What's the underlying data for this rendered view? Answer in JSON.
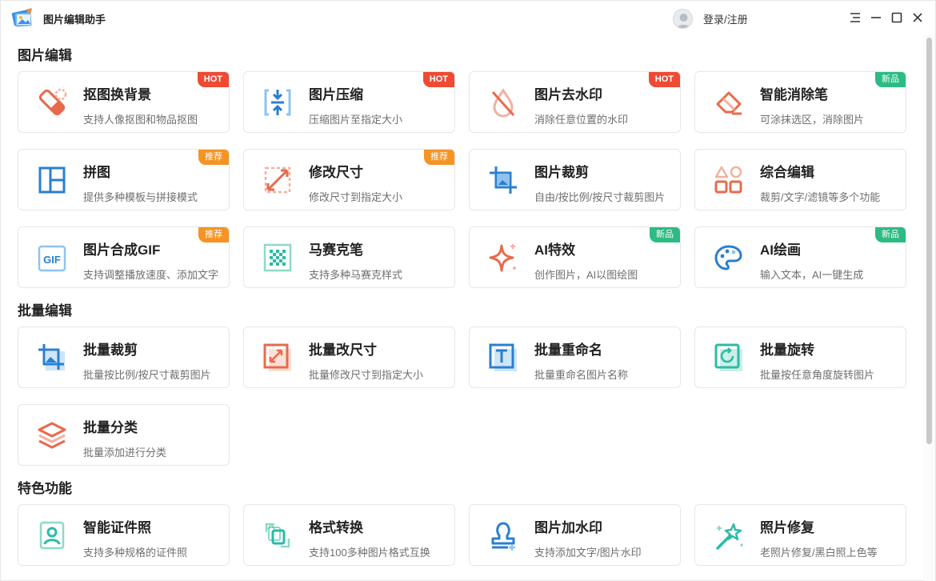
{
  "app": {
    "title": "图片编辑助手",
    "login_label": "登录/注册"
  },
  "colors": {
    "hot": "#ee4a34",
    "recommend": "#f59324",
    "new": "#2dbb84",
    "orange_icon": "#e96a4a",
    "blue_icon": "#2a7fd0",
    "teal_icon": "#2bbba6"
  },
  "sections": [
    {
      "title": "图片编辑",
      "cards": [
        {
          "title": "抠图换背景",
          "desc": "支持人像抠图和物品抠图",
          "badge": "HOT",
          "icon": "eraser-pen-icon"
        },
        {
          "title": "图片压缩",
          "desc": "压缩图片至指定大小",
          "badge": "HOT",
          "icon": "compress-icon"
        },
        {
          "title": "图片去水印",
          "desc": "消除任意位置的水印",
          "badge": "HOT",
          "icon": "water-drop-slash-icon"
        },
        {
          "title": "智能消除笔",
          "desc": "可涂抹选区，消除图片",
          "badge": "新品",
          "icon": "eraser-icon"
        },
        {
          "title": "拼图",
          "desc": "提供多种模板与拼接模式",
          "badge": "推荐",
          "icon": "collage-icon"
        },
        {
          "title": "修改尺寸",
          "desc": "修改尺寸到指定大小",
          "badge": "推荐",
          "icon": "resize-icon"
        },
        {
          "title": "图片裁剪",
          "desc": "自由/按比例/按尺寸裁剪图片",
          "badge": "",
          "icon": "crop-icon"
        },
        {
          "title": "综合编辑",
          "desc": "裁剪/文字/滤镜等多个功能",
          "badge": "",
          "icon": "shapes-icon"
        },
        {
          "title": "图片合成GIF",
          "desc": "支持调整播放速度、添加文字",
          "badge": "推荐",
          "icon": "gif-icon"
        },
        {
          "title": "马赛克笔",
          "desc": "支持多种马赛克样式",
          "badge": "",
          "icon": "mosaic-icon"
        },
        {
          "title": "AI特效",
          "desc": "创作图片，AI以图绘图",
          "badge": "新品",
          "icon": "sparkle-icon"
        },
        {
          "title": "AI绘画",
          "desc": "输入文本，AI一键生成",
          "badge": "新品",
          "icon": "palette-icon"
        }
      ]
    },
    {
      "title": "批量编辑",
      "cards": [
        {
          "title": "批量裁剪",
          "desc": "批量按比例/按尺寸裁剪图片",
          "badge": "",
          "icon": "batch-crop-icon"
        },
        {
          "title": "批量改尺寸",
          "desc": "批量修改尺寸到指定大小",
          "badge": "",
          "icon": "batch-resize-icon"
        },
        {
          "title": "批量重命名",
          "desc": "批量重命名图片名称",
          "badge": "",
          "icon": "rename-icon"
        },
        {
          "title": "批量旋转",
          "desc": "批量按任意角度旋转图片",
          "badge": "",
          "icon": "rotate-icon"
        },
        {
          "title": "批量分类",
          "desc": "批量添加进行分类",
          "badge": "",
          "icon": "layers-icon"
        }
      ]
    },
    {
      "title": "特色功能",
      "cards": [
        {
          "title": "智能证件照",
          "desc": "支持多种规格的证件照",
          "badge": "",
          "icon": "id-photo-icon"
        },
        {
          "title": "格式转换",
          "desc": "支持100多种图片格式互换",
          "badge": "",
          "icon": "format-convert-icon"
        },
        {
          "title": "图片加水印",
          "desc": "支持添加文字/图片水印",
          "badge": "",
          "icon": "stamp-icon"
        },
        {
          "title": "照片修复",
          "desc": "老照片修复/黑白照上色等",
          "badge": "",
          "icon": "magic-wand-icon"
        }
      ]
    }
  ]
}
